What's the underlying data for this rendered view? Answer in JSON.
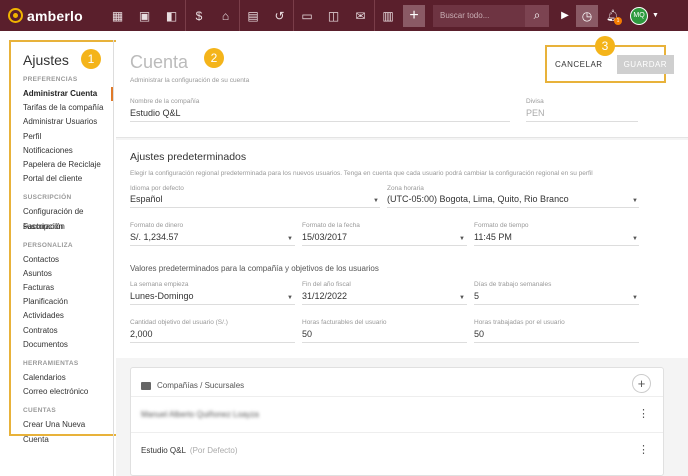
{
  "brand": {
    "name": "amberlo"
  },
  "topbar": {
    "search_placeholder": "Buscar todo...",
    "plus": "+",
    "notification_count": "1",
    "user_initials": "MQ"
  },
  "sidebar": {
    "title": "Ajustes",
    "sections": [
      {
        "label": "PREFERENCIAS",
        "items": [
          "Administrar Cuenta",
          "Tarifas de la compañía",
          "Administrar Usuarios",
          "Perfil",
          "Notificaciones",
          "Papelera de Reciclaje",
          "Portal del cliente"
        ]
      },
      {
        "label": "SUSCRIPCIÓN",
        "items": [
          "Configuración de suscripción",
          "Facturación"
        ]
      },
      {
        "label": "PERSONALIZA",
        "items": [
          "Contactos",
          "Asuntos",
          "Facturas",
          "Planificación",
          "Actividades",
          "Contratos",
          "Documentos"
        ]
      },
      {
        "label": "HERRAMIENTAS",
        "items": [
          "Calendarios",
          "Correo electrónico"
        ]
      },
      {
        "label": "CUENTAS",
        "items": [
          "Crear Una Nueva Cuenta"
        ]
      }
    ]
  },
  "callouts": [
    "1",
    "2",
    "3"
  ],
  "header": {
    "title": "Cuenta",
    "subtitle": "Administrar la configuración de su cuenta",
    "cancel_label": "CANCELAR",
    "save_label": "GUARDAR",
    "company_name_label": "Nombre de la compañía",
    "company_name_value": "Estudio Q&L",
    "currency_label": "Divisa",
    "currency_value": "PEN"
  },
  "defaults": {
    "title": "Ajustes predeterminados",
    "description": "Elegir la configuración regional predeterminada para los nuevos usuarios. Tenga en cuenta que cada usuario podrá cambiar la configuración regional en su perfil",
    "language_label": "Idioma por defecto",
    "language_value": "Español",
    "timezone_label": "Zona horaria",
    "timezone_value": "(UTC-05:00) Bogota, Lima, Quito, Rio Branco",
    "money_label": "Formato de dinero",
    "money_value": "S/. 1,234.57",
    "date_label": "Formato de la fecha",
    "date_value": "15/03/2017",
    "time_label": "Formato de tiempo",
    "time_value": "11:45 PM",
    "sub_title": "Valores predeterminados para la compañía y objetivos de los usuarios",
    "week_label": "La semana empieza",
    "week_value": "Lunes-Domingo",
    "fiscal_label": "Fin del año fiscal",
    "fiscal_value": "31/12/2022",
    "workdays_label": "Días de trabajo semanales",
    "workdays_value": "5",
    "target_label": "Cantidad objetivo del usuario (S/.)",
    "target_value": "2,000",
    "billable_label": "Horas facturables del usuario",
    "billable_value": "50",
    "worked_label": "Horas trabajadas por el usuario",
    "worked_value": "50"
  },
  "companies": {
    "title": "Compañías / Sucursales",
    "rows": [
      {
        "name": "Manuel Alberto Quiñonez Loayza",
        "tag": ""
      },
      {
        "name": "Estudio Q&L",
        "tag": "(Por Defecto)"
      }
    ]
  }
}
